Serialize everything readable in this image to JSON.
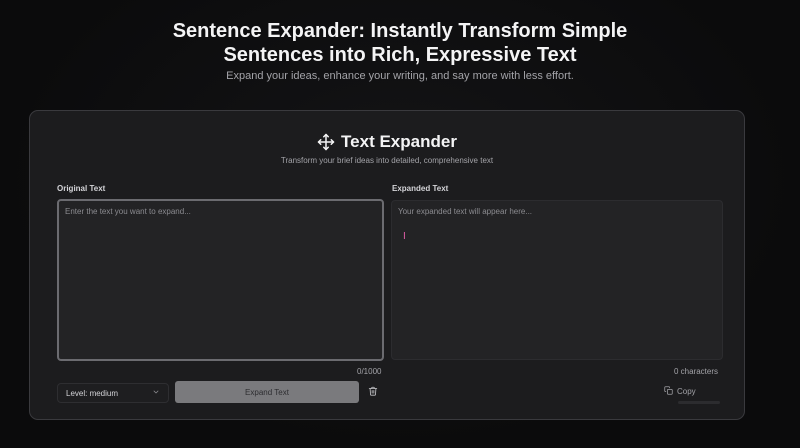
{
  "hero": {
    "title_line1": "Sentence Expander: Instantly Transform Simple",
    "title_line2": "Sentences into Rich, Expressive Text",
    "subtitle": "Expand your ideas, enhance your writing, and say more with less effort."
  },
  "card": {
    "title": "Text Expander",
    "icon": "move-icon",
    "subtitle": "Transform your brief ideas into detailed, comprehensive text"
  },
  "original": {
    "label": "Original Text",
    "placeholder": "Enter the text you want to expand...",
    "value": "",
    "counter": "0/1000"
  },
  "expanded": {
    "label": "Expanded Text",
    "placeholder": "Your expanded text will appear here...",
    "counter": "0 characters"
  },
  "controls": {
    "level_selected": "Level: medium",
    "expand_label": "Expand Text",
    "trash_icon": "trash-icon",
    "copy_label": "Copy",
    "copy_icon": "copy-icon"
  },
  "colors": {
    "background": "#0b0b0c",
    "card": "#1c1c1e",
    "button_disabled": "#7a7a7d",
    "caret": "#e25fa8"
  }
}
